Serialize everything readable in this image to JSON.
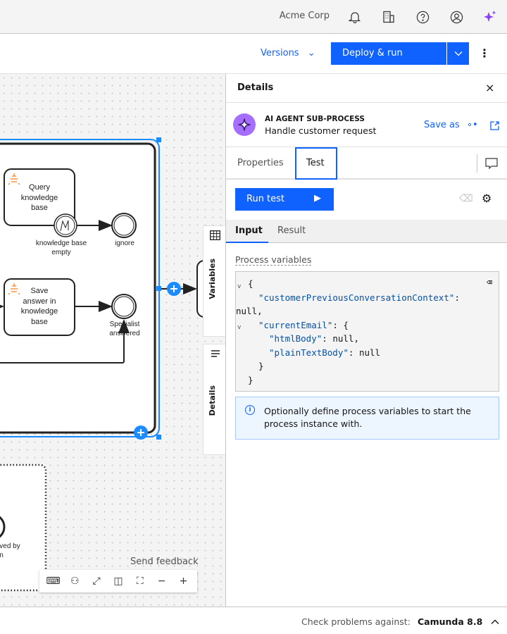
{
  "topbar": {
    "org": "Acme Corp",
    "icons": [
      "bell-icon",
      "building-icon",
      "help-icon",
      "user-icon",
      "sparkle-icon"
    ]
  },
  "toolbar": {
    "versions": "Versions",
    "deploy": "Deploy & run"
  },
  "diagram": {
    "query_task": [
      "Query",
      "knowledge",
      "base"
    ],
    "error_label": [
      "knowledge base",
      "empty"
    ],
    "ignore": "ignore",
    "save_task": [
      "Save",
      "answer in",
      "knowledge",
      "base"
    ],
    "specialist": [
      "Specialist",
      "answered"
    ],
    "lower_label": [
      "ved by",
      "n"
    ]
  },
  "sidetabs": {
    "variables": "Variables",
    "details": "Details"
  },
  "canvas": {
    "feedback": "Send feedback",
    "zoom_tools": [
      "keyboard-icon",
      "reset-icon",
      "fullscreen-icon",
      "minimap-icon",
      "fit-icon",
      "zoom-out-icon",
      "zoom-in-icon"
    ]
  },
  "panel": {
    "title": "Details",
    "element_type": "AI AGENT SUB-PROCESS",
    "element_name": "Handle customer request",
    "save_as": "Save as",
    "tabs": [
      "Properties",
      "Test"
    ],
    "active_tab": "Test",
    "run_test": "Run test",
    "subtabs": [
      "Input",
      "Result"
    ],
    "active_subtab": "Input",
    "vars_label": "Process variables",
    "code": {
      "l1": "{",
      "k1": "\"customerPreviousConversationContext\"",
      "v1": "null,",
      "k2": "\"currentEmail\"",
      "k3": "\"htmlBody\"",
      "k4": "\"plainTextBody\"",
      "null": "null"
    },
    "info": "Optionally define process variables to start the process instance with."
  },
  "bottom": {
    "label": "Check problems against:",
    "version": "Camunda 8.8"
  },
  "colors": {
    "primary": "#0f62fe",
    "selection": "#1a8cff",
    "ai": "#a56eff"
  }
}
